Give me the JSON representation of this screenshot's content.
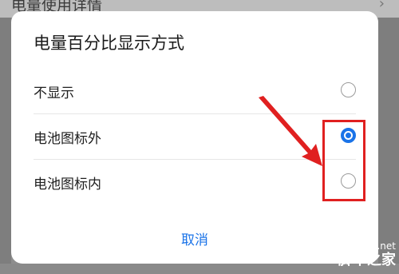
{
  "background": {
    "top_item_label": "电量使用详情"
  },
  "dialog": {
    "title": "电量百分比显示方式",
    "options": [
      {
        "label": "不显示",
        "selected": false
      },
      {
        "label": "电池图标外",
        "selected": true
      },
      {
        "label": "电池图标内",
        "selected": false
      }
    ],
    "cancel_label": "取消"
  },
  "watermark": {
    "url": "jb51.net",
    "name": "脚本之家"
  },
  "colors": {
    "accent": "#1a73e8",
    "annotation": "#e02020"
  }
}
